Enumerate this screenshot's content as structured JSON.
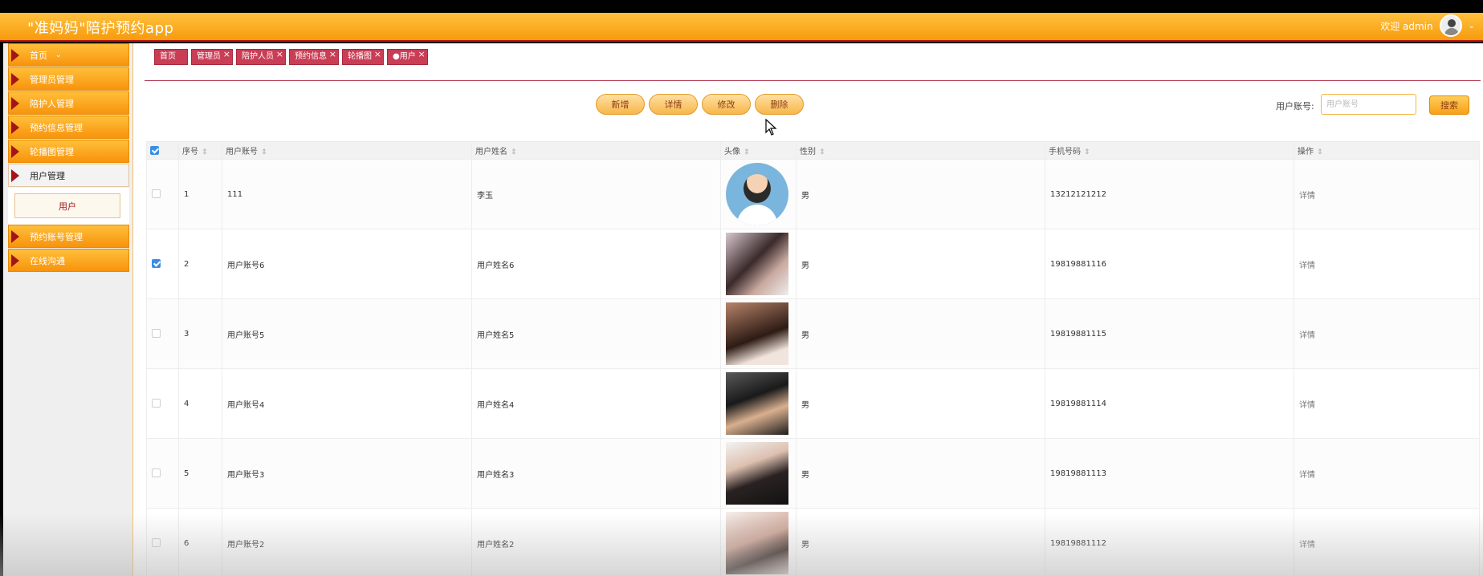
{
  "app": {
    "title": "\"准妈妈\"陪护预约app",
    "welcome": "欢迎 admin"
  },
  "sidebar": {
    "items": [
      {
        "label": "首页",
        "has_chevron": true
      },
      {
        "label": "管理员管理"
      },
      {
        "label": "陪护人管理"
      },
      {
        "label": "预约信息管理"
      },
      {
        "label": "轮播图管理"
      },
      {
        "label": "用户管理",
        "active": true
      },
      {
        "label": "预约账号管理"
      },
      {
        "label": "在线沟通"
      }
    ],
    "submenu": {
      "label": "用户"
    }
  },
  "tabs": [
    "首页",
    "管理员",
    "陪护人员",
    "预约信息",
    "轮播图",
    "●用户"
  ],
  "toolbar": {
    "add": "新增",
    "detail": "详情",
    "edit": "修改",
    "delete": "删除"
  },
  "search": {
    "label": "用户账号:",
    "placeholder": "用户账号",
    "button": "搜索"
  },
  "table": {
    "headers": [
      "序号",
      "用户账号",
      "用户姓名",
      "头像",
      "性别",
      "手机号码",
      "操作"
    ],
    "rows": [
      {
        "index": "1",
        "account": "111",
        "name": "李玉",
        "gender": "男",
        "phone": "13212121212",
        "action": "详情",
        "checked": false,
        "avatar": "cartoon-doctor-avatar"
      },
      {
        "index": "2",
        "account": "用户账号6",
        "name": "用户姓名6",
        "gender": "男",
        "phone": "19819881116",
        "action": "详情",
        "checked": true,
        "avatar": "photo-avatar"
      },
      {
        "index": "3",
        "account": "用户账号5",
        "name": "用户姓名5",
        "gender": "男",
        "phone": "19819881115",
        "action": "详情",
        "checked": false,
        "avatar": "photo-avatar"
      },
      {
        "index": "4",
        "account": "用户账号4",
        "name": "用户姓名4",
        "gender": "男",
        "phone": "19819881114",
        "action": "详情",
        "checked": false,
        "avatar": "photo-avatar"
      },
      {
        "index": "5",
        "account": "用户账号3",
        "name": "用户姓名3",
        "gender": "男",
        "phone": "19819881113",
        "action": "详情",
        "checked": false,
        "avatar": "photo-avatar"
      },
      {
        "index": "6",
        "account": "用户账号2",
        "name": "用户姓名2",
        "gender": "男",
        "phone": "19819881112",
        "action": "详情",
        "checked": false,
        "avatar": "photo-avatar"
      }
    ]
  },
  "colors": {
    "accent": "#f8a019",
    "brand_red": "#c93d55",
    "checkbox_blue": "#3a8ee6"
  }
}
